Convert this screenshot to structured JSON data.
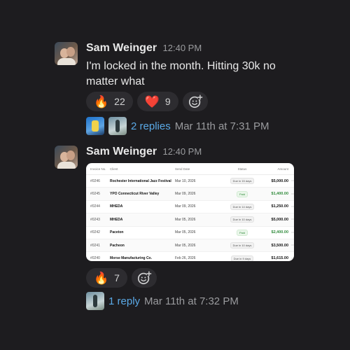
{
  "messages": [
    {
      "author": "Sam Weinger",
      "time": "12:40 PM",
      "text": "I'm locked in the month.  Hitting 30k no matter what",
      "reactions": [
        {
          "emoji": "🔥",
          "count": "22"
        },
        {
          "emoji": "❤️",
          "count": "9"
        }
      ],
      "thread": {
        "replies": "2 replies",
        "last_reply": "Mar 11th at 7:31 PM"
      }
    },
    {
      "author": "Sam Weinger",
      "time": "12:40 PM",
      "reactions": [
        {
          "emoji": "🔥",
          "count": "7"
        }
      ],
      "thread": {
        "replies": "1 reply",
        "last_reply": "Mar 11th at 7:32 PM"
      }
    }
  ],
  "invoice_table": {
    "headers": [
      "Invoice No.",
      "Client",
      "Send Date",
      "Status",
      "Amount"
    ],
    "rows": [
      {
        "no": "#0246",
        "client": "Rochester International Jazz Festival",
        "date": "Mar 10, 2026",
        "status": "Due in 15 days",
        "amount": "$5,000.00",
        "paid": false
      },
      {
        "no": "#0245",
        "client": "YPO Connecticut River Valley",
        "date": "Mar 09, 2026",
        "status": "Paid",
        "amount": "$1,400.00",
        "paid": true
      },
      {
        "no": "#0244",
        "client": "MHEDA",
        "date": "Mar 09, 2026",
        "status": "Due in 14 days",
        "amount": "$1,250.00",
        "paid": false
      },
      {
        "no": "#0243",
        "client": "MHEDA",
        "date": "Mar 05, 2026",
        "status": "Due in 10 days",
        "amount": "$5,000.00",
        "paid": false
      },
      {
        "no": "#0242",
        "client": "Paceton",
        "date": "Mar 05, 2026",
        "status": "Paid",
        "amount": "$2,400.00",
        "paid": true
      },
      {
        "no": "#0241",
        "client": "Pacheon",
        "date": "Mar 05, 2026",
        "status": "Due in 10 days",
        "amount": "$3,500.00",
        "paid": false
      },
      {
        "no": "#0240",
        "client": "Morse Manufacturing Co.",
        "date": "Feb 26, 2026",
        "status": "Due in 9 days",
        "amount": "$1,615.00",
        "paid": false
      }
    ],
    "more_icon": "⋯"
  },
  "colors": {
    "background": "#1d1c1f",
    "link": "#5aa9e6",
    "paid_green": "#2f8a3a"
  }
}
